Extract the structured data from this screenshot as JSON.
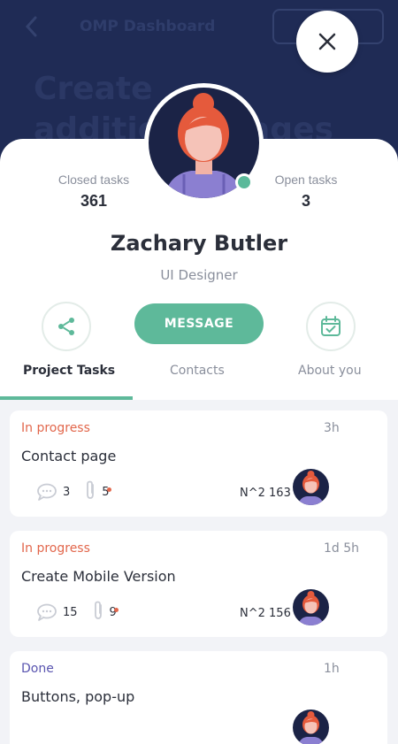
{
  "background": {
    "header_title": "OMP Dashboard",
    "heading": "Create additional pages"
  },
  "profile": {
    "closed_tasks_label": "Closed tasks",
    "closed_tasks_value": "361",
    "open_tasks_label": "Open tasks",
    "open_tasks_value": "3",
    "name": "Zachary Butler",
    "role": "UI Designer",
    "message_label": "MESSAGE"
  },
  "tabs": {
    "project_tasks": "Project Tasks",
    "contacts": "Contacts",
    "about": "About you"
  },
  "tasks": [
    {
      "status": "In progress",
      "time": "3h",
      "title": "Contact page",
      "comments": "3",
      "attachments": "5",
      "code": "N^2 163",
      "status_color": "#e2674c"
    },
    {
      "status": "In progress",
      "time": "1d 5h",
      "title": "Create Mobile Version",
      "comments": "15",
      "attachments": "9",
      "code": "N^2 156",
      "status_color": "#e2674c"
    },
    {
      "status": "Done",
      "time": "1h",
      "title": "Buttons, pop-up",
      "status_color": "#5a55b0"
    }
  ],
  "colors": {
    "accent": "#5eb99a",
    "navy": "#1f2b55",
    "in_progress": "#e2674c",
    "done": "#5a55b0"
  }
}
